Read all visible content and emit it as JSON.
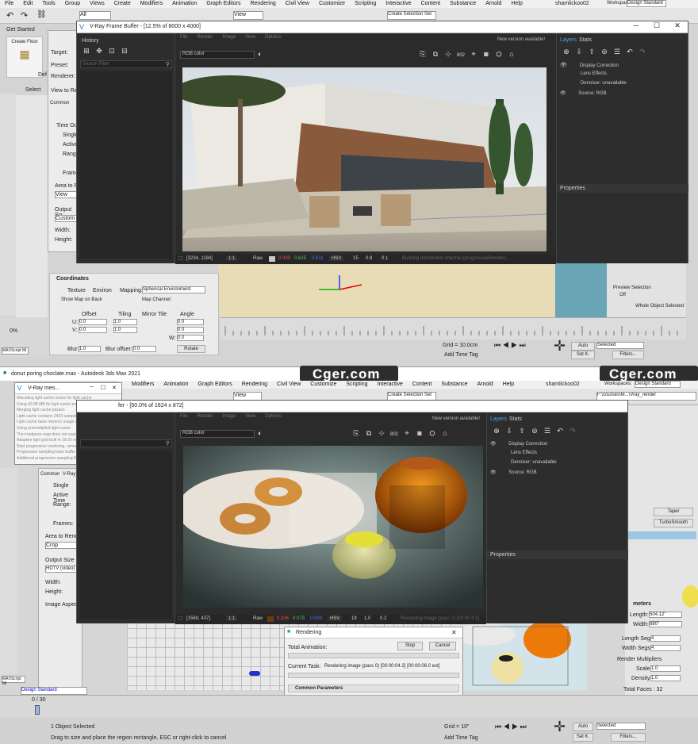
{
  "top": {
    "menu": [
      "File",
      "Edit",
      "Tools",
      "Group",
      "Views",
      "Create",
      "Modifiers",
      "Animation",
      "Graph Editors",
      "Rendering",
      "Civil View",
      "Customize",
      "Scripting",
      "Interactive",
      "Content",
      "Substance",
      "Arnold",
      "Help"
    ],
    "user": "shamlickoo02",
    "workspaces_label": "Workspaces:",
    "workspace": "Design Standard",
    "all_label": "All",
    "view_label": "View",
    "create_sel": "Create Selection Set",
    "get_started": "Get Started",
    "create_floor": "Create Floor",
    "select_label": "Select",
    "def_label": "Def",
    "render_setup_labels": [
      "Target:",
      "Preset:",
      "Renderer:",
      "View to Render:"
    ],
    "render_tabs": [
      "Common"
    ],
    "time_output": [
      "Time Ou",
      "Single",
      "Active",
      "Range:",
      "Frames"
    ],
    "area_to_render": "Area to Rende",
    "view": "View",
    "output_size": "Output Siz",
    "custom": "Custom",
    "width": "Width:",
    "height": "Height:"
  },
  "vfb_top": {
    "title": "V-Ray Frame Buffer - [12.5% of 8000 x 4000]",
    "history": "History",
    "search_filter": "Search Filter",
    "menu": [
      "File",
      "Render",
      "Image",
      "View",
      "Options"
    ],
    "new_version": "New version available!",
    "channel": "RGB color",
    "layers_tab": "Layers",
    "stats_tab": "Stats",
    "layers": [
      "Display Correction",
      "Lens Effects",
      "Denoiser: unavailable",
      "Source: RGB"
    ],
    "properties": "Properties",
    "coords": "[3234, 1184]",
    "zoom": "1:1",
    "raw": "Raw",
    "r": "0.000",
    "g": "0.625",
    "b": "0.611",
    "mode": "HSV",
    "v1": "15",
    "v2": "0.8",
    "v3": "0.1",
    "status": "Building distribution channel (progressiveRender)..."
  },
  "top_bottom_panel": {
    "coordinates": "Coordinates",
    "texture": "Texture",
    "environ": "Environ",
    "mapping": "Mapping:",
    "mapping_value": "Spherical Environment",
    "show_map": "Show Map on Back",
    "map_channel": "Map Channel:",
    "headers": [
      "Offset",
      "Tiling",
      "Mirror Tile",
      "Angle"
    ],
    "rows": [
      "U:",
      "V:",
      "W:"
    ],
    "offset": [
      "0.0",
      "0.0"
    ],
    "tiling": [
      "1.0",
      "1.0"
    ],
    "angle": [
      "0.0",
      "0.0",
      "0.0"
    ],
    "blur": "Blur:",
    "blur_val": "1.0",
    "blur_offset": "Blur offset:",
    "blur_offset_val": "0.0",
    "rotate": "Rotate",
    "maxscript": "MAXScript Mi",
    "percent": "0%",
    "preview_selection": "Preview Selection",
    "off": "Off",
    "whole_object": "Whole Object Selected",
    "add_time_tag": "Add Time Tag",
    "grid": "Grid = 10.0cm",
    "auto": "Auto",
    "selected": "Selected",
    "set_k": "Set K.",
    "filters": "Filters..."
  },
  "divider": {
    "title": "donut poring choclate.max - Autodesk 3ds Max 2021",
    "watermark_left": "Cger.com",
    "watermark_right": "Cger.com"
  },
  "log_window": {
    "title": "V-Ray mes...",
    "lines": [
      "Allocating light cache nodes for light cache",
      "Using 43.38 MB for light cache preview buffer",
      "Merging light cache passes",
      "Light cache contains 2423 samples",
      "Light cache base memory usage is 0.6 MB",
      "Using premultiplied light cache",
      "The irradiance map does not support reflective",
      "Adaptive light grid built in 19.03 ms",
      "Start progressive rendering, server mode 0, pa",
      "Progressive sampling base buffer memory usa",
      "Additional progressive sampling filter buffers n"
    ]
  },
  "bottom_left": {
    "common": "Common",
    "vray": "V-Ray",
    "time_labels": [
      "Single",
      "Active Time",
      "Range:",
      "Frames:"
    ],
    "area_to_render": "Area to Rende",
    "crop": "Crop",
    "output_size": "Output Size",
    "hdtv": "HDTV (video)",
    "width": "Width:",
    "height": "Height:",
    "aspect": "Image Aspect:",
    "maxscript": "MAXScript Mi",
    "design_standard": "Design Standard",
    "frame": "0 / 30",
    "objects": "1 Object Selected",
    "hint": "Drag to size and place the region rectangle, ESC or right-click to cancel"
  },
  "vfb_bottom": {
    "title": "fer - [50.0% of 1624 x 872]",
    "menu": [
      "File",
      "Render",
      "Image",
      "View",
      "Options"
    ],
    "new_version": "New version available!",
    "channel": "RGB color",
    "layers_tab": "Layers",
    "stats_tab": "Stats",
    "layers": [
      "Display Correction",
      "Lens Effects",
      "Denoiser: unavailable",
      "Source: RGB"
    ],
    "properties": "Properties",
    "coords": "[1569, 437]",
    "zoom": "1:1",
    "raw": "Raw",
    "r": "0.326",
    "g": "0.073",
    "b": "0.000",
    "mode": "HSV",
    "v1": "19",
    "v2": "1.0",
    "v3": "0.2",
    "status": "Rendering image (pass 0) [00:00:4.2]"
  },
  "bottom_right": {
    "workspaces_label": "Workspaces:",
    "workspace": "Design Standard",
    "path": "F:\\courses\\M...\\Vray_render",
    "taper": "Taper",
    "turbosmooth": "TurboSmooth",
    "parameters": "meters",
    "length": "Length:",
    "length_val": "504.12\"",
    "width": "Width:",
    "width_val": "880\"",
    "length_segs": "Length Segs:",
    "length_segs_val": "4",
    "width_segs": "Width Segs:",
    "width_segs_val": "4",
    "render_multipliers": "Render Multipliers",
    "scale": "Scale:",
    "scale_val": "1.0",
    "density": "Density:",
    "density_val": "1.0",
    "total_faces": "Total Faces : 32",
    "grid": "Grid = 10\"",
    "auto": "Auto",
    "selected": "Selected",
    "set_k": "Set K.",
    "filters": "Filters...",
    "add_time_tag": "Add Time Tag"
  },
  "rendering_dialog": {
    "title": "Rendering",
    "total_animation": "Total Animation:",
    "stop": "Stop",
    "cancel": "Cancel",
    "current_task": "Current Task:",
    "task": "Rendering image (pass 0) [00:00:04.2] [00:00:06.0 est]",
    "common_params": "Common Parameters"
  }
}
